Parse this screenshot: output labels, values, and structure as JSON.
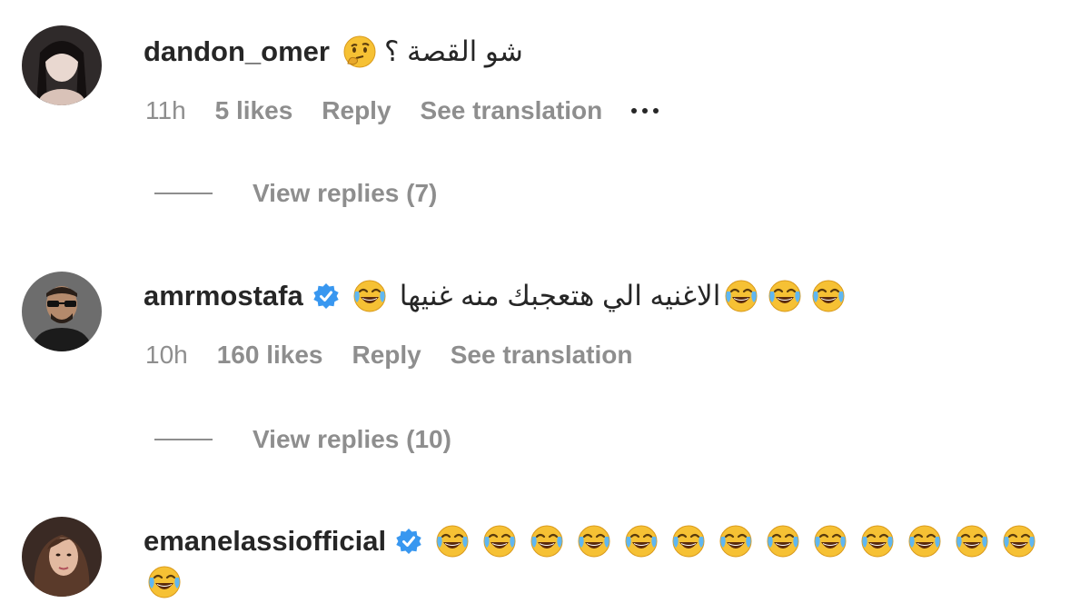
{
  "colors": {
    "text_primary": "#262626",
    "text_secondary": "#8e8e8e",
    "verified_badge": "#3897f0",
    "emoji_face": "#f6c134"
  },
  "comments": [
    {
      "username": "dandon_omer",
      "verified": false,
      "text": "شو القصة ؟",
      "emoji": "thinking-face",
      "time": "11h",
      "likes": "5 likes",
      "reply_label": "Reply",
      "translate_label": "See translation",
      "more_icon": "ellipsis-icon",
      "view_replies": "View replies (7)"
    },
    {
      "username": "amrmostafa",
      "verified": true,
      "text": "الاغنيه الي هتعجبك منه غنيها",
      "emoji": "face-with-tears-of-joy",
      "time": "10h",
      "likes": "160 likes",
      "reply_label": "Reply",
      "translate_label": "See translation",
      "view_replies": "View replies (10)"
    },
    {
      "username": "emanelassiofficial",
      "verified": true,
      "emoji": "face-with-tears-of-joy",
      "emoji_count": 14
    }
  ]
}
